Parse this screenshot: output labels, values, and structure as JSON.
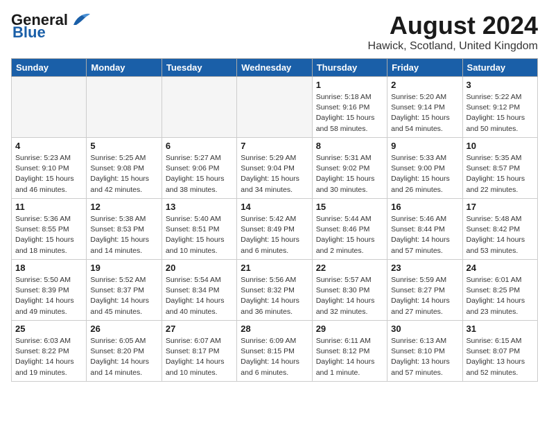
{
  "header": {
    "logo_line1": "General",
    "logo_line2": "Blue",
    "main_title": "August 2024",
    "subtitle": "Hawick, Scotland, United Kingdom"
  },
  "days_of_week": [
    "Sunday",
    "Monday",
    "Tuesday",
    "Wednesday",
    "Thursday",
    "Friday",
    "Saturday"
  ],
  "weeks": [
    [
      {
        "day": "",
        "info": ""
      },
      {
        "day": "",
        "info": ""
      },
      {
        "day": "",
        "info": ""
      },
      {
        "day": "",
        "info": ""
      },
      {
        "day": "1",
        "info": "Sunrise: 5:18 AM\nSunset: 9:16 PM\nDaylight: 15 hours\nand 58 minutes."
      },
      {
        "day": "2",
        "info": "Sunrise: 5:20 AM\nSunset: 9:14 PM\nDaylight: 15 hours\nand 54 minutes."
      },
      {
        "day": "3",
        "info": "Sunrise: 5:22 AM\nSunset: 9:12 PM\nDaylight: 15 hours\nand 50 minutes."
      }
    ],
    [
      {
        "day": "4",
        "info": "Sunrise: 5:23 AM\nSunset: 9:10 PM\nDaylight: 15 hours\nand 46 minutes."
      },
      {
        "day": "5",
        "info": "Sunrise: 5:25 AM\nSunset: 9:08 PM\nDaylight: 15 hours\nand 42 minutes."
      },
      {
        "day": "6",
        "info": "Sunrise: 5:27 AM\nSunset: 9:06 PM\nDaylight: 15 hours\nand 38 minutes."
      },
      {
        "day": "7",
        "info": "Sunrise: 5:29 AM\nSunset: 9:04 PM\nDaylight: 15 hours\nand 34 minutes."
      },
      {
        "day": "8",
        "info": "Sunrise: 5:31 AM\nSunset: 9:02 PM\nDaylight: 15 hours\nand 30 minutes."
      },
      {
        "day": "9",
        "info": "Sunrise: 5:33 AM\nSunset: 9:00 PM\nDaylight: 15 hours\nand 26 minutes."
      },
      {
        "day": "10",
        "info": "Sunrise: 5:35 AM\nSunset: 8:57 PM\nDaylight: 15 hours\nand 22 minutes."
      }
    ],
    [
      {
        "day": "11",
        "info": "Sunrise: 5:36 AM\nSunset: 8:55 PM\nDaylight: 15 hours\nand 18 minutes."
      },
      {
        "day": "12",
        "info": "Sunrise: 5:38 AM\nSunset: 8:53 PM\nDaylight: 15 hours\nand 14 minutes."
      },
      {
        "day": "13",
        "info": "Sunrise: 5:40 AM\nSunset: 8:51 PM\nDaylight: 15 hours\nand 10 minutes."
      },
      {
        "day": "14",
        "info": "Sunrise: 5:42 AM\nSunset: 8:49 PM\nDaylight: 15 hours\nand 6 minutes."
      },
      {
        "day": "15",
        "info": "Sunrise: 5:44 AM\nSunset: 8:46 PM\nDaylight: 15 hours\nand 2 minutes."
      },
      {
        "day": "16",
        "info": "Sunrise: 5:46 AM\nSunset: 8:44 PM\nDaylight: 14 hours\nand 57 minutes."
      },
      {
        "day": "17",
        "info": "Sunrise: 5:48 AM\nSunset: 8:42 PM\nDaylight: 14 hours\nand 53 minutes."
      }
    ],
    [
      {
        "day": "18",
        "info": "Sunrise: 5:50 AM\nSunset: 8:39 PM\nDaylight: 14 hours\nand 49 minutes."
      },
      {
        "day": "19",
        "info": "Sunrise: 5:52 AM\nSunset: 8:37 PM\nDaylight: 14 hours\nand 45 minutes."
      },
      {
        "day": "20",
        "info": "Sunrise: 5:54 AM\nSunset: 8:34 PM\nDaylight: 14 hours\nand 40 minutes."
      },
      {
        "day": "21",
        "info": "Sunrise: 5:56 AM\nSunset: 8:32 PM\nDaylight: 14 hours\nand 36 minutes."
      },
      {
        "day": "22",
        "info": "Sunrise: 5:57 AM\nSunset: 8:30 PM\nDaylight: 14 hours\nand 32 minutes."
      },
      {
        "day": "23",
        "info": "Sunrise: 5:59 AM\nSunset: 8:27 PM\nDaylight: 14 hours\nand 27 minutes."
      },
      {
        "day": "24",
        "info": "Sunrise: 6:01 AM\nSunset: 8:25 PM\nDaylight: 14 hours\nand 23 minutes."
      }
    ],
    [
      {
        "day": "25",
        "info": "Sunrise: 6:03 AM\nSunset: 8:22 PM\nDaylight: 14 hours\nand 19 minutes."
      },
      {
        "day": "26",
        "info": "Sunrise: 6:05 AM\nSunset: 8:20 PM\nDaylight: 14 hours\nand 14 minutes."
      },
      {
        "day": "27",
        "info": "Sunrise: 6:07 AM\nSunset: 8:17 PM\nDaylight: 14 hours\nand 10 minutes."
      },
      {
        "day": "28",
        "info": "Sunrise: 6:09 AM\nSunset: 8:15 PM\nDaylight: 14 hours\nand 6 minutes."
      },
      {
        "day": "29",
        "info": "Sunrise: 6:11 AM\nSunset: 8:12 PM\nDaylight: 14 hours\nand 1 minute."
      },
      {
        "day": "30",
        "info": "Sunrise: 6:13 AM\nSunset: 8:10 PM\nDaylight: 13 hours\nand 57 minutes."
      },
      {
        "day": "31",
        "info": "Sunrise: 6:15 AM\nSunset: 8:07 PM\nDaylight: 13 hours\nand 52 minutes."
      }
    ]
  ]
}
